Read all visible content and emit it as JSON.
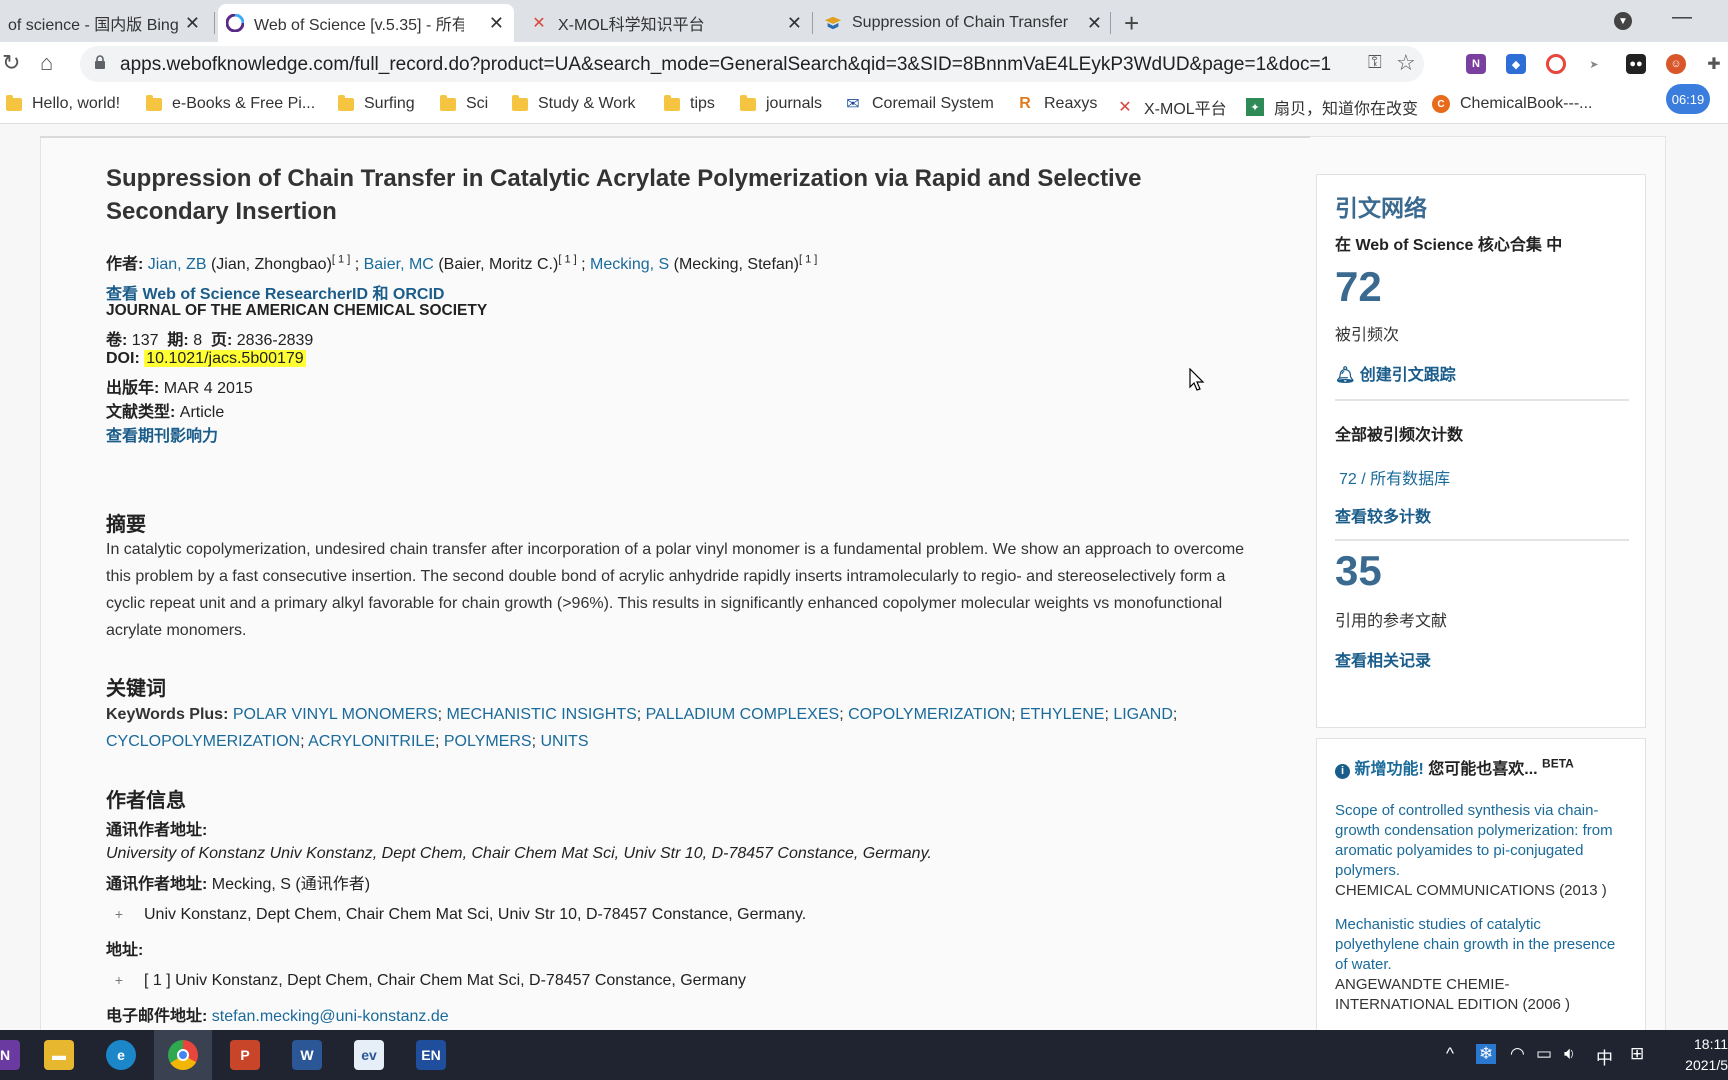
{
  "browser": {
    "tabs": [
      {
        "title": "of science - 国内版 Bing",
        "active": false
      },
      {
        "title": "Web of Science [v.5.35] - 所有",
        "active": true
      },
      {
        "title": "X-MOL科学知识平台",
        "active": false
      },
      {
        "title": "Suppression of Chain Transfer",
        "active": false
      }
    ],
    "url": "apps.webofknowledge.com/full_record.do?product=UA&search_mode=GeneralSearch&qid=3&SID=8BnnmVaE4LEykP3WdUD&page=1&doc=1",
    "bookmarks": [
      "Hello, world!",
      "e-Books & Free Pi...",
      "Surfing",
      "Sci",
      "Study & Work",
      "tips",
      "journals",
      "Coremail System",
      "Reaxys",
      "X-MOL平台",
      "扇贝，知道你在改变",
      "ChemicalBook---..."
    ],
    "clock_badge": "06:19"
  },
  "record": {
    "title": "Suppression of Chain Transfer in Catalytic Acrylate Polymerization via Rapid and Selective Secondary Insertion",
    "authors_label": "作者:",
    "authors": [
      {
        "short": "Jian, ZB",
        "full": "(Jian, Zhongbao)",
        "ref": "[ 1 ]",
        "sep": ";"
      },
      {
        "short": "Baier, MC",
        "full": "(Baier, Moritz C.)",
        "ref": "[ 1 ]",
        "sep": ";"
      },
      {
        "short": "Mecking, S",
        "full": "(Mecking, Stefan)",
        "ref": "[ 1 ]",
        "sep": ""
      }
    ],
    "researcher_link": "查看 Web of Science ResearcherID 和 ORCID",
    "journal": "JOURNAL OF THE AMERICAN CHEMICAL SOCIETY",
    "volume_label": "卷:",
    "volume": "137",
    "issue_label": "期:",
    "issue": "8",
    "pages_label": "页:",
    "pages": "2836-2839",
    "doi_label": "DOI:",
    "doi": "10.1021/jacs.5b00179",
    "year_label": "出版年:",
    "year": "MAR 4 2015",
    "doctype_label": "文献类型:",
    "doctype": "Article",
    "impact_link": "查看期刊影响力",
    "abstract_heading": "摘要",
    "abstract": "In catalytic copolymerization, undesired chain transfer after incorporation of a polar vinyl monomer is a fundamental problem. We show an approach to overcome this problem by a fast consecutive insertion. The second double bond of acrylic anhydride rapidly inserts intramolecularly to regio- and stereoselectively form a cyclic repeat unit and a primary alkyl favorable for chain growth (>96%). This results in significantly enhanced copolymer molecular weights vs monofunctional acrylate monomers.",
    "keywords_heading": "关键词",
    "keywords_label": "KeyWords Plus:",
    "keywords": [
      "POLAR VINYL MONOMERS",
      "MECHANISTIC INSIGHTS",
      "PALLADIUM COMPLEXES",
      "COPOLYMERIZATION",
      "ETHYLENE",
      "LIGAND",
      "CYCLOPOLYMERIZATION",
      "ACRYLONITRILE",
      "POLYMERS",
      "UNITS"
    ],
    "author_info_heading": "作者信息",
    "corr_addr_label": "通讯作者地址:",
    "corr_addr_italic": "University of Konstanz Univ Konstanz, Dept Chem, Chair Chem Mat Sci, Univ Str 10, D-78457 Constance, Germany.",
    "corr_addr2_label": "通讯作者地址:",
    "corr_addr2_value": "Mecking, S (通讯作者)",
    "corr_addr2_detail": "Univ Konstanz, Dept Chem, Chair Chem Mat Sci, Univ Str 10, D-78457 Constance, Germany.",
    "addr_label": "地址:",
    "addr_detail": "[ 1 ] Univ Konstanz, Dept Chem, Chair Chem Mat Sci, D-78457 Constance, Germany",
    "email_label": "电子邮件地址:",
    "email": "stefan.mecking@uni-konstanz.de"
  },
  "sidebar": {
    "heading": "引文网络",
    "core_label": "在 Web of Science 核心合集 中",
    "times_cited": "72",
    "times_cited_label": "被引频次",
    "alert_link": "创建引文跟踪",
    "all_counts_label": "全部被引频次计数",
    "all_counts_num": "72",
    "all_counts_db": " / 所有数据库",
    "more_counts_link": "查看较多计数",
    "refs": "35",
    "refs_label": "引用的参考文献",
    "related_link": "查看相关记录",
    "new_feature": "新增功能!",
    "you_may_like": "您可能也喜欢...",
    "beta": "BETA",
    "recommendations": [
      {
        "title": "Scope of controlled synthesis via chain-growth condensation polymerization: from aromatic polyamides to pi-conjugated polymers.",
        "journal": "CHEMICAL COMMUNICATIONS (2013 )"
      },
      {
        "title": "Mechanistic studies of catalytic polyethylene chain growth in the presence of water.",
        "journal": "ANGEWANDTE CHEMIE-INTERNATIONAL EDITION (2006 )"
      }
    ]
  },
  "taskbar": {
    "ime": "中",
    "time": "18:11",
    "date": "2021/5"
  }
}
